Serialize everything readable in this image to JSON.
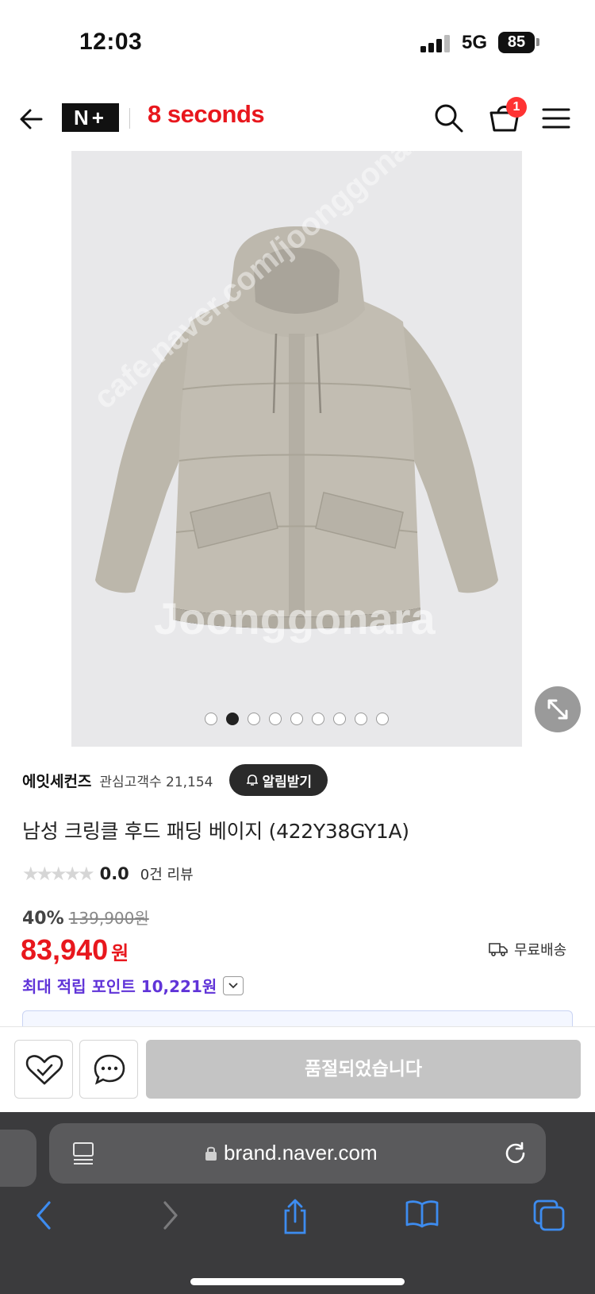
{
  "status": {
    "time": "12:03",
    "network": "5G",
    "battery": "85"
  },
  "header": {
    "badge_label": "N+",
    "brand_logo": "8 seconds",
    "cart_count": "1"
  },
  "gallery": {
    "watermark": "Joonggonara",
    "watermark_url": "cafe.naver.com/joonggonara",
    "slide_count": 9,
    "active_slide": 2
  },
  "product": {
    "brand": "에잇세컨즈",
    "fans_label": "관심고객수 21,154",
    "alarm_label": "알림받기",
    "title": "남성 크링클 후드 패딩 베이지 (422Y38GY1A)",
    "stars": "★★★★★",
    "rating": "0.0",
    "review_count": "0건 리뷰",
    "discount": "40%",
    "original_price": "139,900원",
    "price": "83,940",
    "currency": "원",
    "shipping": "무료배송",
    "points": "최대 적립 포인트 10,221원"
  },
  "actions": {
    "soldout_label": "품절되었습니다"
  },
  "safari": {
    "url": "brand.naver.com"
  },
  "colors": {
    "brand_red": "#e8171d",
    "points_purple": "#6034d8",
    "safari_icon_blue": "#3d8cf0"
  }
}
